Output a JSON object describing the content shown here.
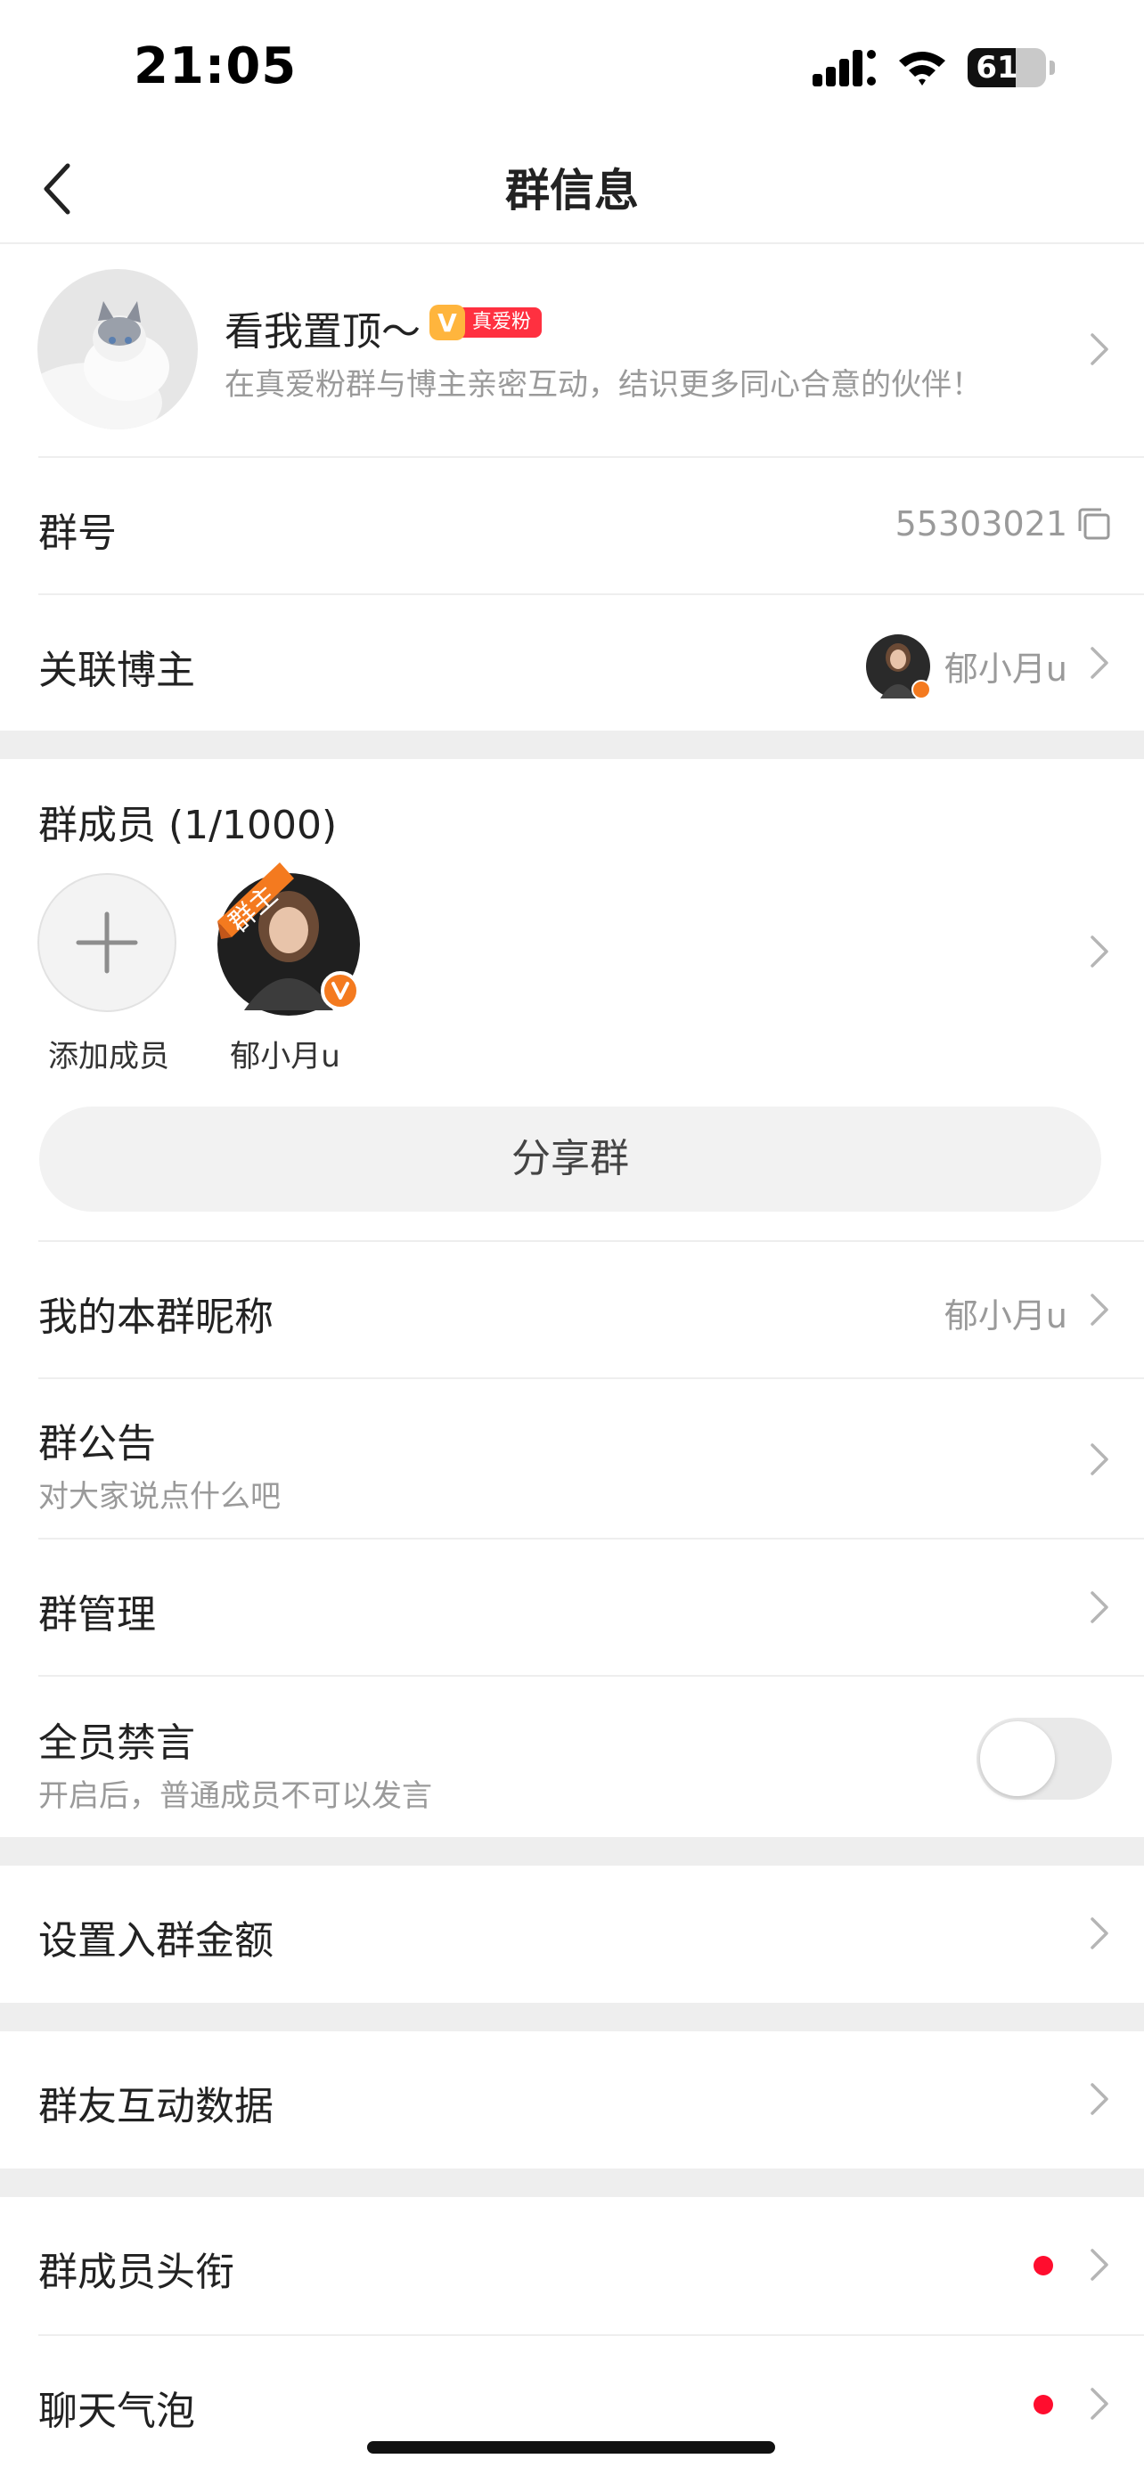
{
  "status_bar": {
    "time": "21:05",
    "battery_percent": "61",
    "battery_level": 0.61
  },
  "nav": {
    "title": "群信息"
  },
  "group": {
    "name": "看我置顶～",
    "badge_v": "V",
    "badge_text": "真爱粉",
    "description": "在真爱粉群与博主亲密互动，结识更多同心合意的伙伴！"
  },
  "group_number": {
    "label": "群号",
    "value": "55303021"
  },
  "linked_blogger": {
    "label": "关联博主",
    "name": "郁小月u"
  },
  "members": {
    "title": "群成员 (1/1000)",
    "add_label": "添加成员",
    "owner_tag": "群主",
    "owner_name": "郁小月u",
    "verified_mark": "V"
  },
  "share_button": "分享群",
  "settings": {
    "my_nickname": {
      "label": "我的本群昵称",
      "value": "郁小月u"
    },
    "announcement": {
      "label": "群公告",
      "sub": "对大家说点什么吧"
    },
    "management": {
      "label": "群管理"
    },
    "mute_all": {
      "label": "全员禁言",
      "sub": "开启后，普通成员不可以发言",
      "enabled": false
    },
    "entry_fee": {
      "label": "设置入群金额"
    },
    "interaction_data": {
      "label": "群友互动数据"
    },
    "member_titles": {
      "label": "群成员头衔"
    },
    "chat_bubble": {
      "label": "聊天气泡"
    }
  },
  "colors": {
    "accent_orange": "#f47a1f",
    "red_dot": "#ff0d2e",
    "badge_red": "#ff3040",
    "badge_gold": "#ffb53d"
  }
}
